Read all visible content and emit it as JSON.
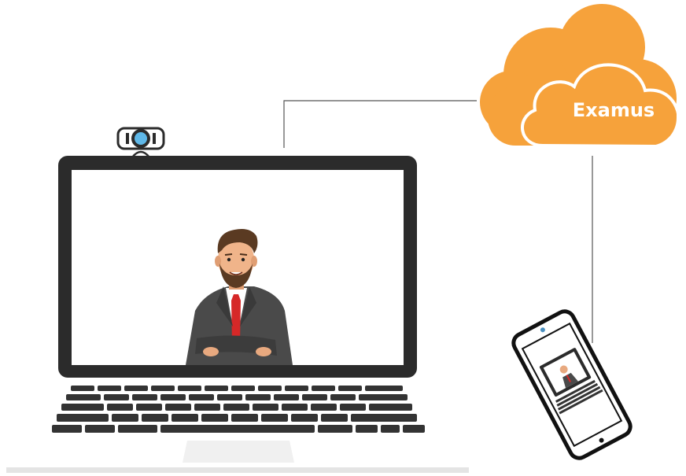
{
  "cloud": {
    "label": "Examus",
    "color": "#F6A23B"
  },
  "icons": {
    "webcam": "webcam-icon",
    "laptop": "laptop-icon",
    "phone": "smartphone-icon",
    "person": "businessman-avatar"
  },
  "colors": {
    "device_frame": "#2b2b2b",
    "connector_line": "#555555",
    "keyboard_key": "#333333",
    "suit": "#4a4a4a",
    "tie": "#d62828"
  }
}
